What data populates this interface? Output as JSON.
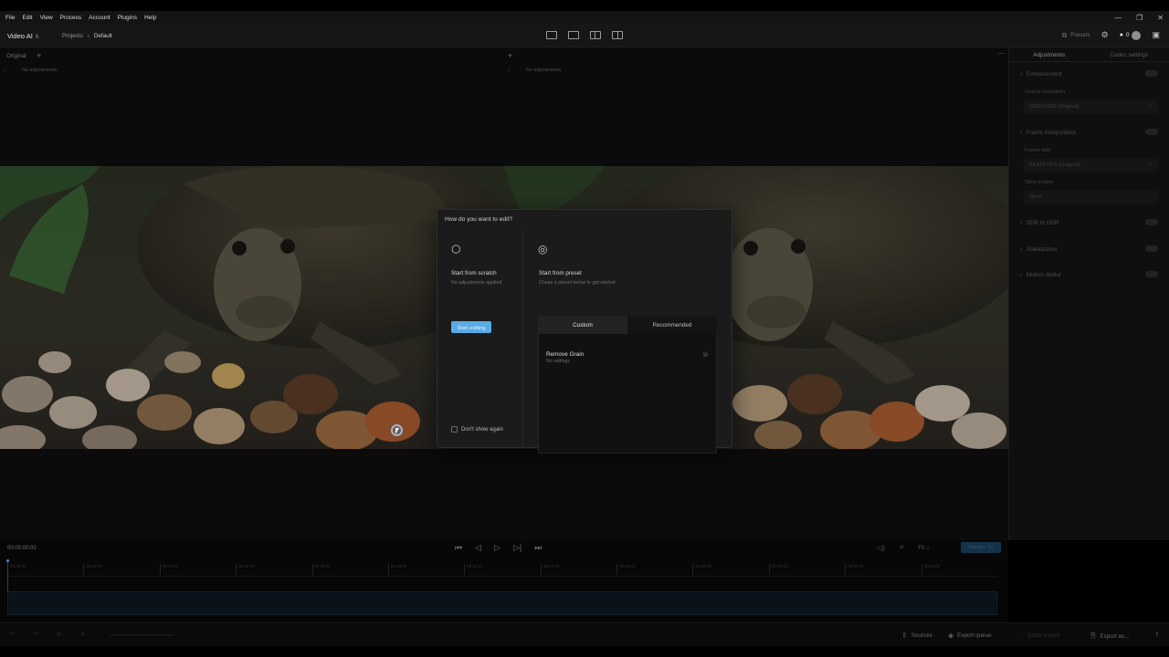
{
  "menubar": {
    "items": [
      "File",
      "Edit",
      "View",
      "Process",
      "Account",
      "Plugins",
      "Help"
    ],
    "window_controls": [
      "—",
      "❐",
      "✕"
    ]
  },
  "header": {
    "app_name": "Video AI",
    "app_version": "6",
    "breadcrumb": [
      "Projects",
      "Default"
    ],
    "presets_label": "Presets",
    "credits": "0"
  },
  "viewer": {
    "left_label": "Original",
    "left_sub": "No adjustments",
    "right_sub": "No adjustments"
  },
  "right_panel": {
    "tabs": [
      "Adjustments",
      "Codec settings"
    ],
    "enhancement": "Enhancement",
    "output_resolution_label": "Output resolution",
    "output_resolution_value": "1920×1080 (Original)",
    "frame_interpolation": "Frame interpolation",
    "frame_rate_label": "Frame rate",
    "frame_rate_value": "59.528 FPS (Original)",
    "slow_motion_label": "Slow motion",
    "slow_motion_value": "None",
    "sdr_to_hdr": "SDR to HDR",
    "stabilization": "Stabilization",
    "motion_deblur": "Motion deblur"
  },
  "dialog": {
    "title": "How do you want to edit?",
    "scratch_title": "Start from scratch",
    "scratch_sub": "No adjustments applied",
    "start_editing": "Start editing",
    "preset_title": "Start from preset",
    "preset_sub": "Chose a preset below to get started",
    "tabs": [
      "Custom",
      "Recommended"
    ],
    "presets": [
      {
        "name": "Remove Grain",
        "sub": "No settings"
      }
    ],
    "dont_show": "Don't show again"
  },
  "timeline": {
    "current_time": "00:00:00:00",
    "fit_label": "Fit",
    "render_label": "Render 2s",
    "ticks": [
      "00:00:00",
      "00:02:00",
      "00:04:00",
      "00:06:00",
      "00:08:00",
      "00:10:00",
      "00:12:00",
      "00:14:00",
      "00:16:00",
      "00:18:00",
      "00:20:00",
      "00:22:00",
      "00:24:00"
    ]
  },
  "bottom_bar": {
    "sources": "Sources",
    "export_queue": "Export queue",
    "quick_export": "Quick export",
    "export_as": "Export as..."
  }
}
